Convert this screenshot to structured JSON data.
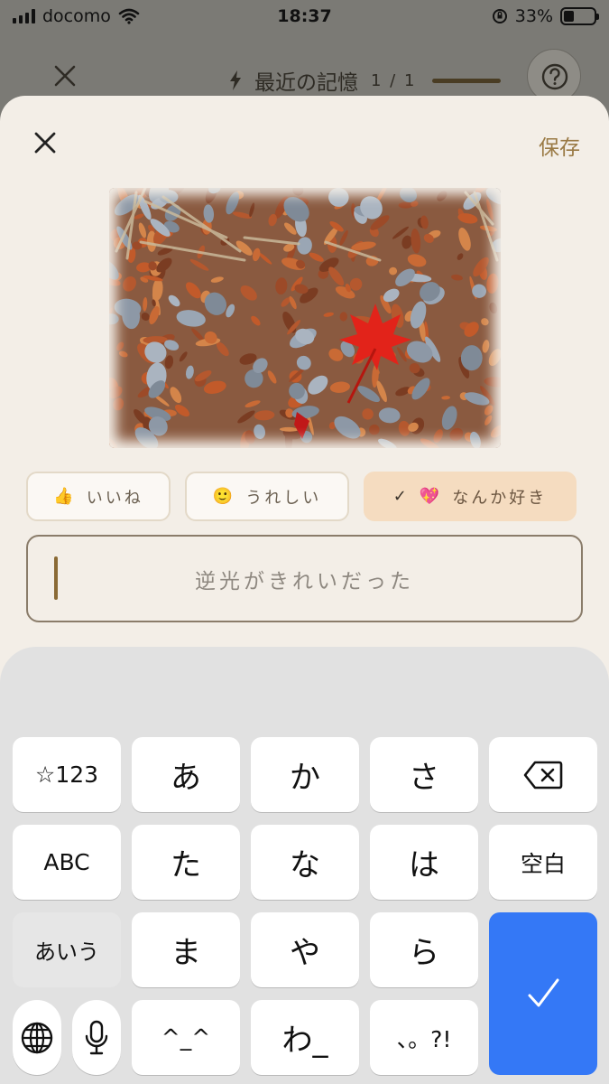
{
  "status_bar": {
    "carrier": "docomo",
    "time": "18:37",
    "battery": "33%",
    "battery_level": 0.33
  },
  "header": {
    "title": "最近の記憶",
    "count": "1 / 1"
  },
  "sheet": {
    "save_label": "保存"
  },
  "reactions": [
    {
      "emoji": "👍",
      "label": "いいね",
      "selected": false
    },
    {
      "emoji": "🙂",
      "label": "うれしい",
      "selected": false
    },
    {
      "emoji": "💖",
      "label": "なんか好き",
      "selected": true,
      "check": "✓"
    }
  ],
  "note": {
    "value": "逆光がきれいだった"
  },
  "keyboard": {
    "keys": {
      "num": "☆123",
      "a": "あ",
      "ka": "か",
      "sa": "さ",
      "abc": "ABC",
      "ta": "た",
      "na": "な",
      "ha": "は",
      "space": "空白",
      "aiu": "あいう",
      "ma": "ま",
      "ya": "や",
      "ra": "ら",
      "kaomoji": "^_^",
      "wa": "わ_",
      "punct": "、。?!"
    }
  }
}
